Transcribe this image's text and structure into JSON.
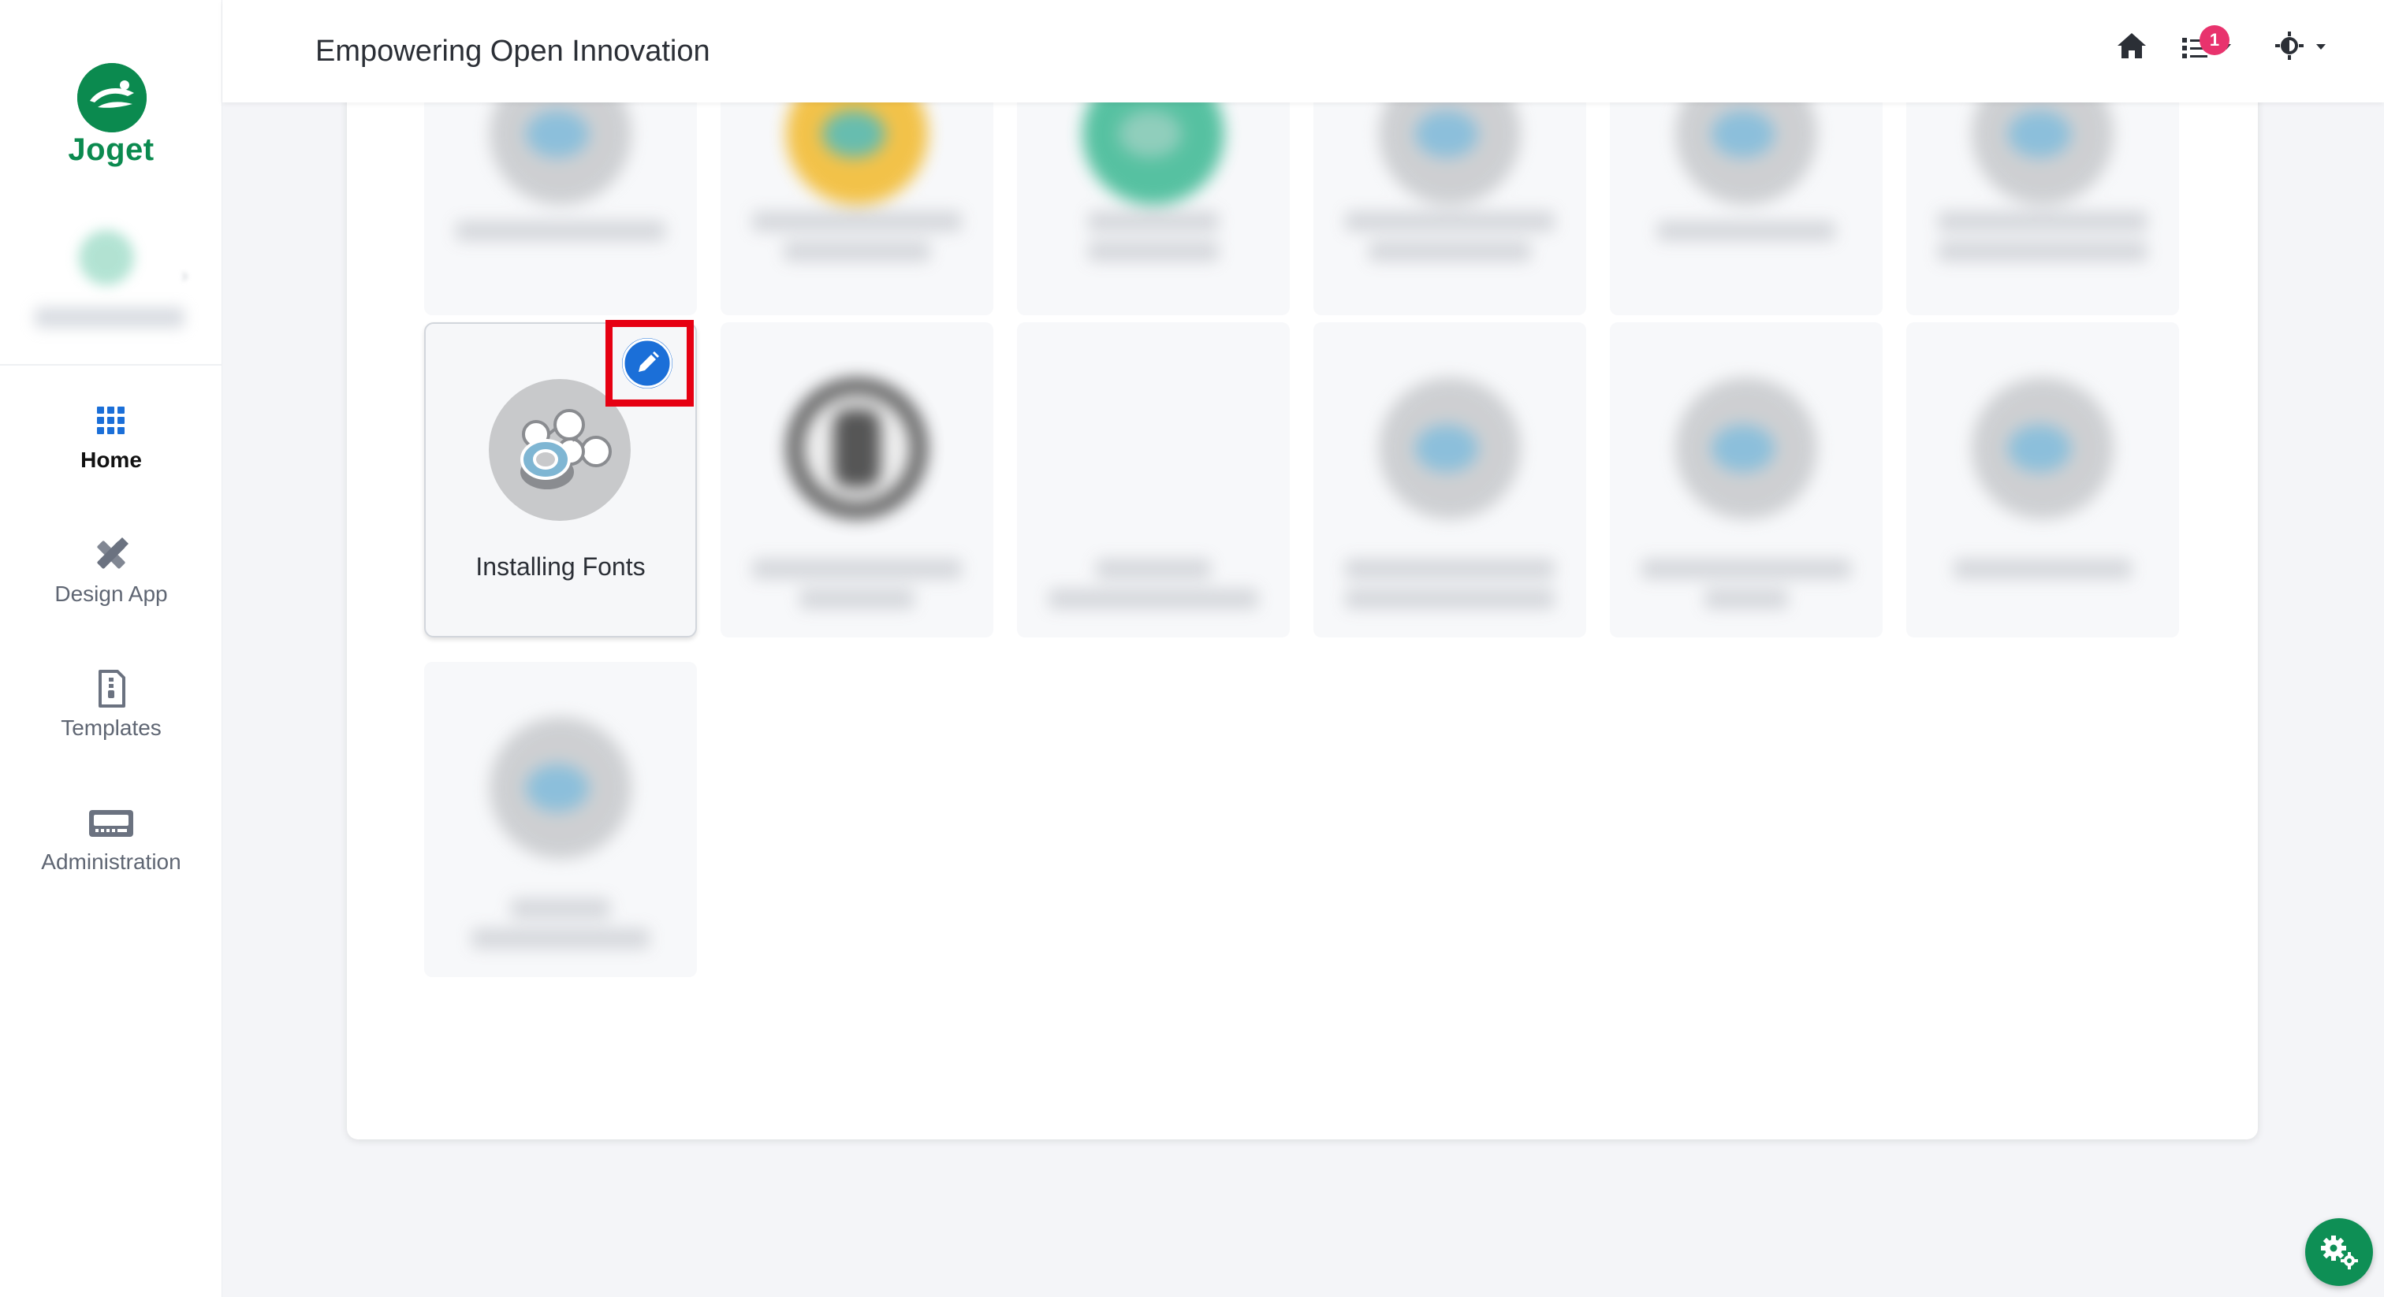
{
  "brand": {
    "name": "Joget",
    "color": "#0b8a4f"
  },
  "header": {
    "title": "Empowering Open Innovation",
    "notification_count": "1"
  },
  "sidebar": {
    "items": [
      {
        "label": "Home",
        "icon": "grid-icon",
        "active": true
      },
      {
        "label": "Design App",
        "icon": "design-tools-icon",
        "active": false
      },
      {
        "label": "Templates",
        "icon": "template-file-icon",
        "active": false
      },
      {
        "label": "Administration",
        "icon": "admin-console-icon",
        "active": false
      }
    ]
  },
  "apps": {
    "highlighted": {
      "name": "Installing Fonts",
      "icon": "app-network-icon",
      "edit_icon": "pencil-icon"
    }
  },
  "colors": {
    "accent": "#1b6fd8",
    "highlight_border": "#e60012",
    "badge": "#e8336d",
    "fab": "#0e8f55"
  }
}
